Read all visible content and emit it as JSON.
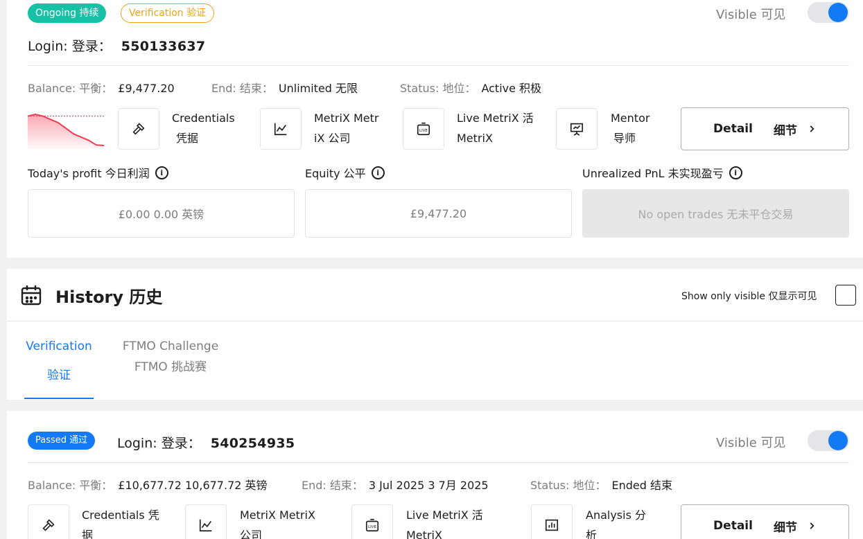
{
  "current_account": {
    "badges": {
      "ongoing": "Ongoing 持续",
      "verification": "Verification 验证"
    },
    "visible_label": "Visible 可见",
    "login_label": "Login: 登录：",
    "login_number": "550133637",
    "balance": {
      "label": "Balance: 平衡：",
      "value": "£9,477.20"
    },
    "end": {
      "label": "End: 结束：",
      "value": "Unlimited 无限"
    },
    "status": {
      "label": "Status: 地位：",
      "value": "Active 积极"
    },
    "tools": [
      {
        "line1": "Credentials",
        "line2": "凭据",
        "icon": "gavel-icon"
      },
      {
        "line1": "MetriX Metr",
        "line2": "iX 公司",
        "icon": "line-chart-icon"
      },
      {
        "line1": "Live MetriX 活",
        "line2": "MetriX",
        "icon": "live-icon"
      },
      {
        "line1": "Mentor",
        "line2": "导师",
        "icon": "presentation-icon"
      }
    ],
    "detail_button": {
      "label": "Detail",
      "label_cn": "细节"
    },
    "stats": {
      "todays_profit": {
        "label": "Today's profit 今日利润",
        "value": "£0.00 0.00 英镑"
      },
      "equity": {
        "label": "Equity 公平",
        "value": "£9,477.20"
      },
      "unrealized_pnl": {
        "label": "Unrealized PnL 未实现盈亏",
        "value": "No open trades 无未平仓交易"
      }
    },
    "sparkline": {
      "color": "#f23b52",
      "values": [
        100,
        104,
        100,
        93,
        86,
        74,
        62,
        55,
        48,
        38,
        37
      ],
      "target_line": 100
    }
  },
  "history": {
    "title": "History 历史",
    "show_only_visible": "Show only visible 仅显示可见",
    "tabs": [
      {
        "line1": "Verification",
        "line2": "验证",
        "active": true
      },
      {
        "line1": "FTMO Challenge",
        "line2": "FTMO 挑战赛",
        "active": false
      }
    ]
  },
  "past_account": {
    "badge": "Passed 通过",
    "visible_label": "Visible 可见",
    "login_label": "Login: 登录：",
    "login_number": "540254935",
    "balance": {
      "label": "Balance: 平衡：",
      "value": "£10,677.72 10,677.72 英镑"
    },
    "end": {
      "label": "End: 结束：",
      "value": "3 Jul 2025 3 7月 2025"
    },
    "status": {
      "label": "Status: 地位：",
      "value": "Ended 结束"
    },
    "tools": [
      {
        "line1": "Credentials 凭",
        "line2": "据",
        "icon": "gavel-icon"
      },
      {
        "line1": "MetriX MetriX",
        "line2": "公司",
        "icon": "line-chart-icon"
      },
      {
        "line1": "Live MetriX 活",
        "line2": "MetriX",
        "icon": "live-icon"
      },
      {
        "line1": "Analysis 分",
        "line2": "析",
        "icon": "bar-chart-icon"
      }
    ],
    "detail_button": {
      "label": "Detail",
      "label_cn": "细节"
    }
  },
  "colors": {
    "accent": "#1479f5",
    "success": "#16c1a6",
    "warning": "#f3a21a",
    "loss": "#f23b52"
  }
}
